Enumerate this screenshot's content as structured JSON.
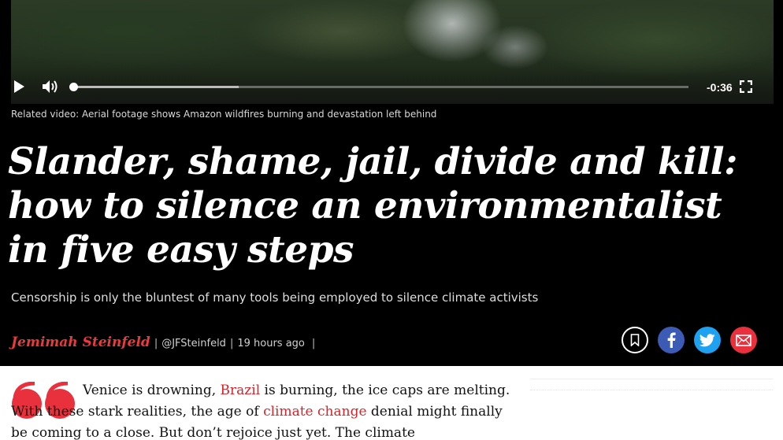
{
  "video": {
    "time_remaining": "-0:36",
    "progress_fraction": 0.0,
    "buffered_fraction": 0.27,
    "caption": "Related video: Aerial footage shows Amazon wildfires burning and devastation left behind"
  },
  "article": {
    "headline": "Slander, shame, jail, divide and kill: how to silence an environmentalist in five easy steps",
    "standfirst": "Censorship is only the bluntest of many tools being employed to silence climate activists",
    "byline": {
      "author": "Jemimah Steinfeld",
      "separator": "|",
      "handle": "@JFSteinfeld",
      "time": "19 hours ago"
    },
    "body": {
      "part1": "Venice is drowning, ",
      "link1": "Brazil",
      "part2": " is burning, the ice caps are melting. With these stark realities, the age of ",
      "link2": "climate change",
      "part3": " denial might finally be coming to a close. But don’t rejoice just yet. The climate"
    }
  },
  "share": {
    "bookmark": "bookmark-icon",
    "facebook": "facebook-icon",
    "twitter": "twitter-icon",
    "email": "email-icon"
  },
  "colors": {
    "background": "#000000",
    "accent": "#e83a3f",
    "facebook": "#3b5bb4",
    "twitter": "#1fa1f1",
    "email": "#e8313c",
    "link": "#d92229"
  }
}
